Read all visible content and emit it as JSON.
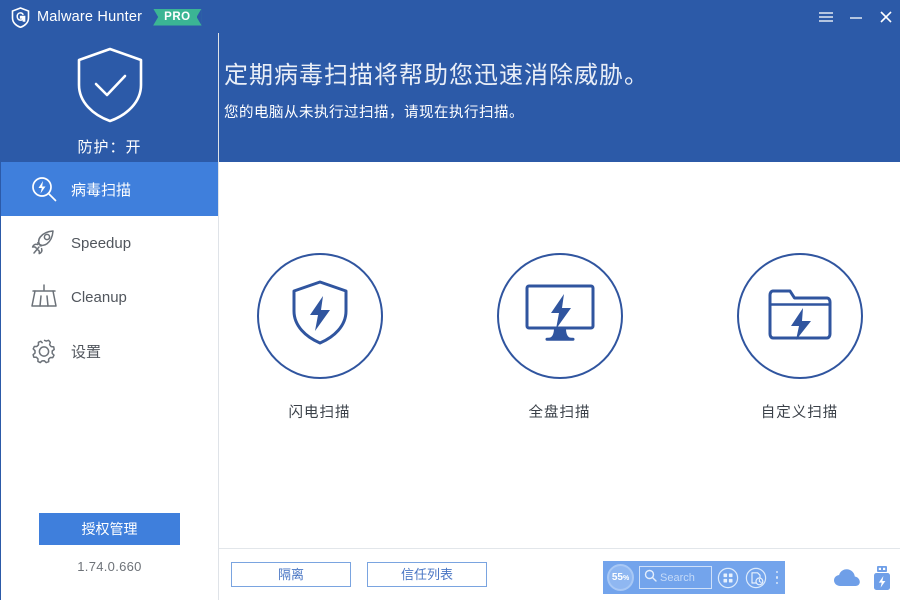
{
  "window": {
    "title": "Malware Hunter",
    "badge": "PRO",
    "controls": [
      {
        "name": "menu-button",
        "icon": "hamburger-icon"
      },
      {
        "name": "minimize-button",
        "icon": "minimize-icon"
      },
      {
        "name": "close-button",
        "icon": "close-icon"
      }
    ]
  },
  "sidebar": {
    "protection_status": "防护：开",
    "shield_icon": "shield-check-icon",
    "items": [
      {
        "label": "病毒扫描",
        "icon": "virus-scan-icon",
        "active": true
      },
      {
        "label": "Speedup",
        "icon": "rocket-icon",
        "active": false
      },
      {
        "label": "Cleanup",
        "icon": "broom-icon",
        "active": false
      },
      {
        "label": "设置",
        "icon": "gear-icon",
        "active": false
      }
    ],
    "license_button": "授权管理",
    "version": "1.74.0.660"
  },
  "banner": {
    "headline": "定期病毒扫描将帮助您迅速消除威胁。",
    "subline": "您的电脑从未执行过扫描，请现在执行扫描。"
  },
  "main": {
    "scan_options": [
      {
        "label": "闪电扫描",
        "icon": "shield-bolt-icon"
      },
      {
        "label": "全盘扫描",
        "icon": "monitor-bolt-icon"
      },
      {
        "label": "自定义扫描",
        "icon": "folder-bolt-icon"
      }
    ],
    "footer_buttons": [
      {
        "label": "隔离",
        "name": "quarantine-button"
      },
      {
        "label": "信任列表",
        "name": "trust-list-button"
      }
    ]
  },
  "widget": {
    "gauge_value": "55",
    "gauge_unit": "%",
    "search_placeholder": "Search",
    "icons": [
      {
        "name": "apps-grid-icon"
      },
      {
        "name": "history-document-icon"
      },
      {
        "name": "more-options-icon"
      }
    ]
  },
  "tray": [
    {
      "name": "cloud-icon"
    },
    {
      "name": "usb-bolt-icon"
    }
  ],
  "colors": {
    "title_bar": "#2c5aa8",
    "accent": "#3f7fdc",
    "badge": "#3bb594",
    "icon_outline": "#30559f",
    "widget_bg": "#73a4ec"
  }
}
